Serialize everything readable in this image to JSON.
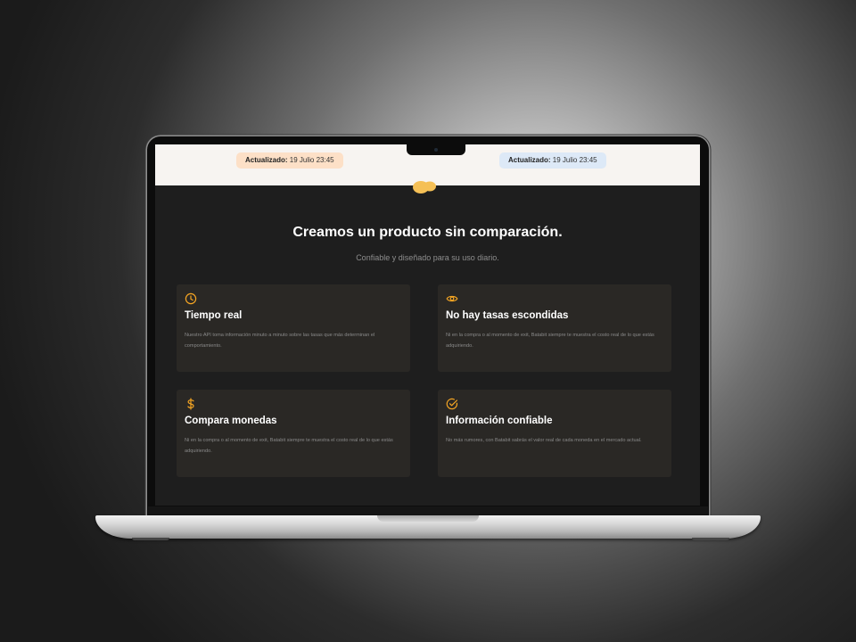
{
  "header": {
    "updated_left": {
      "label": "Actualizado:",
      "value": "19 Julio 23:45"
    },
    "updated_right": {
      "label": "Actualizado:",
      "value": "19 Julio 23:45"
    }
  },
  "logo": {
    "icon": "blob-logo-icon",
    "color": "#f5c056"
  },
  "hero": {
    "title": "Creamos un producto sin comparación.",
    "subtitle": "Confiable y diseñado para su uso diario."
  },
  "features": [
    {
      "icon": "clock-icon",
      "title": "Tiempo real",
      "text": "Nuestro API toma información minuto a minuto sobre las tasas que más determinan el comportamiento."
    },
    {
      "icon": "eye-icon",
      "title": "No hay tasas escondidas",
      "text": "Ni en la compra o al momento de exit, Batabit siempre te muestra el costo real de lo que estás adquiriendo."
    },
    {
      "icon": "dollar-icon",
      "title": "Compara monedas",
      "text": "Ni en la compra o al momento de exit, Batabit siempre te muestra el costo real de lo que estás adquiriendo."
    },
    {
      "icon": "check-circle-icon",
      "title": "Información confiable",
      "text": "No más rumores, con Batabit sabrás el valor real de cada moneda en el mercado actual."
    }
  ],
  "colors": {
    "accent": "#f6a623",
    "background": "#1e1e1e",
    "card": "#2a2825",
    "pill_orange": "#fde0c7",
    "pill_blue": "#dde9f7"
  }
}
